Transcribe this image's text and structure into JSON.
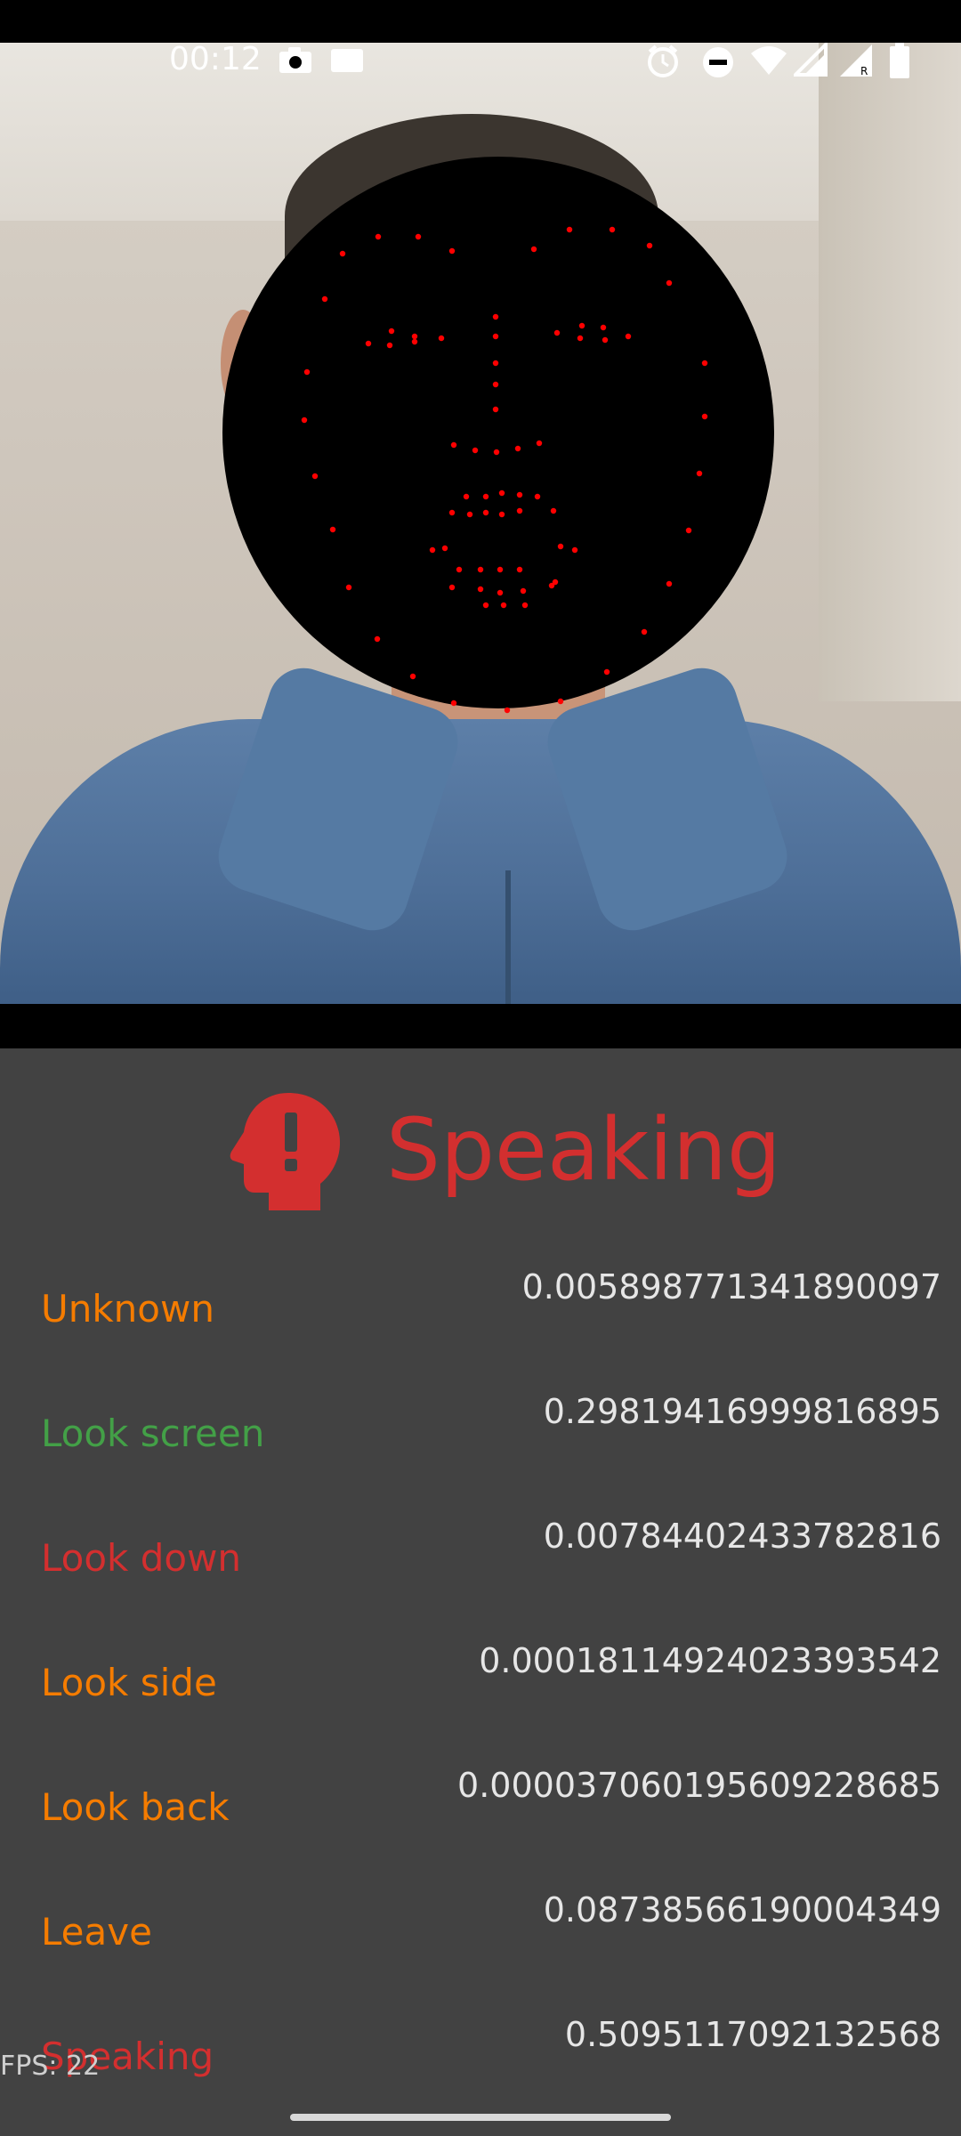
{
  "status_bar": {
    "time": "00:12",
    "icons": [
      "camera-icon",
      "image-icon",
      "alarm-icon",
      "do-not-disturb-icon",
      "wifi-icon",
      "signal-icon",
      "signal-roaming-icon",
      "battery-icon"
    ]
  },
  "camera": {
    "mask_color": "#000000",
    "landmark_color": "#ff0000"
  },
  "status": {
    "icon": "head-alert-icon",
    "label": "Speaking",
    "color": "#d32f2f"
  },
  "classifications": [
    {
      "label": "Unknown",
      "value": "0.005898771341890097",
      "color": "#f57c00"
    },
    {
      "label": "Look screen",
      "value": "0.29819416999816895",
      "color": "#43a047"
    },
    {
      "label": "Look down",
      "value": "0.00784402433782816",
      "color": "#d32f2f"
    },
    {
      "label": "Look side",
      "value": "0.00018114924023393542",
      "color": "#f57c00"
    },
    {
      "label": "Look back",
      "value": "0.000037060195609228685",
      "color": "#f57c00"
    },
    {
      "label": "Leave",
      "value": "0.08738566190004349",
      "color": "#f57c00"
    },
    {
      "label": "Speaking",
      "value": "0.5095117092132568",
      "color": "#d32f2f"
    }
  ],
  "fps": "FPS: 22"
}
